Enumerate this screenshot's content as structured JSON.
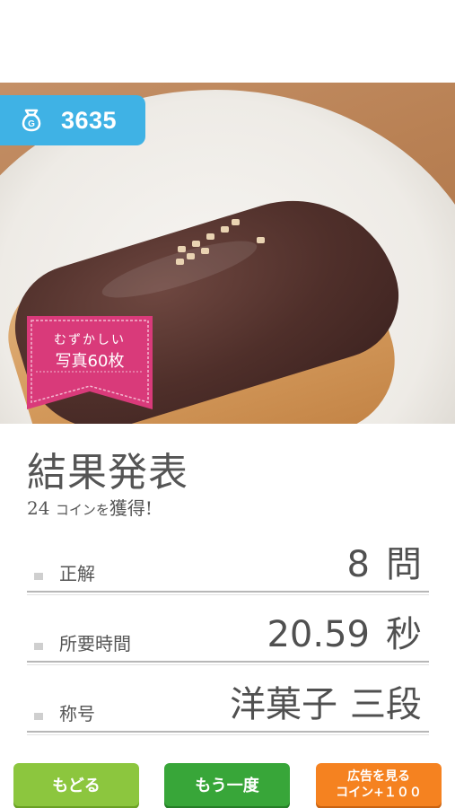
{
  "header": {
    "coin_count": "3635"
  },
  "photo": {
    "difficulty_line1": "むずかしい",
    "difficulty_line2": "写真60枚"
  },
  "result": {
    "title": "結果発表",
    "coins_earned_number": "24",
    "coins_earned_text_small": "コインを",
    "coins_earned_text_end": "獲得!",
    "rows": [
      {
        "label": "正解",
        "value_number": "8",
        "value_unit": "問"
      },
      {
        "label": "所要時間",
        "value_number": "20.59",
        "value_unit": "秒"
      },
      {
        "label": "称号",
        "value_number": "洋菓子",
        "value_unit": "三段"
      }
    ]
  },
  "buttons": {
    "back": "もどる",
    "retry": "もう一度",
    "ad_line1": "広告を見る",
    "ad_line2": "コイン+１００"
  },
  "colors": {
    "coin_badge": "#3fb2e5",
    "ribbon": "#d93a7a",
    "back": "#8cc63e",
    "retry": "#38a639",
    "ad": "#f58220"
  },
  "icons": {
    "coin_bag": "coin-bag-icon"
  }
}
